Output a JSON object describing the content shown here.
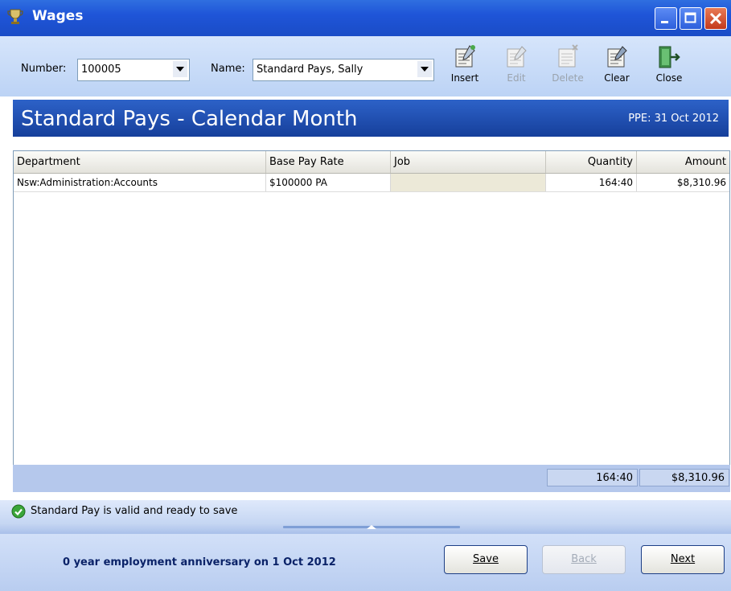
{
  "window": {
    "title": "Wages",
    "app_icon": "trophy-icon",
    "controls": [
      "minimize-icon",
      "maximize-icon",
      "close-icon"
    ]
  },
  "toolbar": {
    "number_label": "Number:",
    "number_value": "100005",
    "name_label": "Name:",
    "name_value": "Standard Pays, Sally",
    "buttons": [
      {
        "label": "Insert",
        "icon": "insert-icon",
        "enabled": true
      },
      {
        "label": "Edit",
        "icon": "edit-icon",
        "enabled": false
      },
      {
        "label": "Delete",
        "icon": "delete-icon",
        "enabled": false
      },
      {
        "label": "Clear",
        "icon": "clear-icon",
        "enabled": true
      },
      {
        "label": "Close",
        "icon": "door-exit-icon",
        "enabled": true
      }
    ]
  },
  "banner": {
    "title": "Standard Pays - Calendar Month",
    "ppe": "PPE: 31 Oct 2012"
  },
  "grid": {
    "columns": [
      "Department",
      "Base Pay Rate",
      "Job",
      "Quantity",
      "Amount"
    ],
    "rows": [
      {
        "department": "Nsw:Administration:Accounts",
        "base_pay_rate": "$100000 PA",
        "job": "",
        "quantity": "164:40",
        "amount": "$8,310.96"
      }
    ]
  },
  "totals": {
    "quantity": "164:40",
    "amount": "$8,310.96"
  },
  "status": {
    "icon": "check-circle-icon",
    "text": "Standard Pay is valid and ready to save"
  },
  "footer": {
    "anniversary": "0 year employment anniversary on 1 Oct 2012",
    "save_label": "Save",
    "back_label": "Back",
    "next_label": "Next"
  },
  "colors": {
    "title_bar": "#1f55d8",
    "banner": "#1f4fb0",
    "panel": "#c6d7f3",
    "status_ok": "#2e9b2e"
  }
}
